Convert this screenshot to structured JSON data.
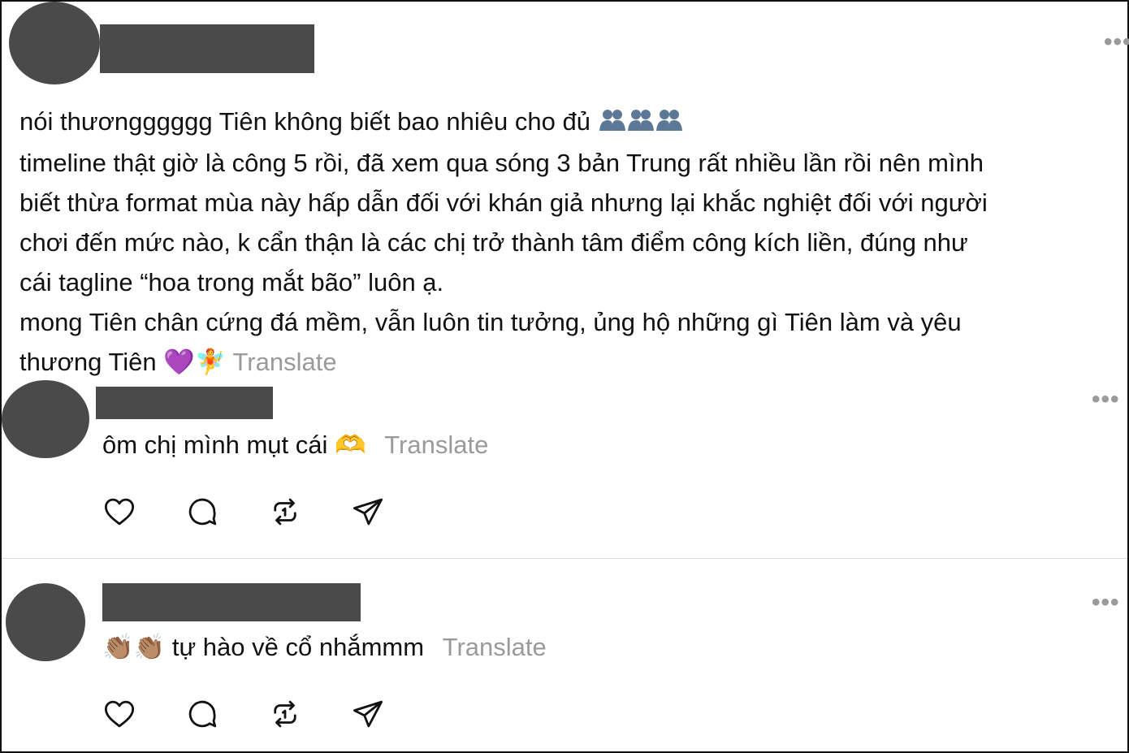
{
  "post": {
    "lines": [
      "nói thươngggggg Tiên không biết bao nhiêu cho đủ",
      "timeline thật giờ là công 5 rồi, đã xem qua sóng 3 bản Trung rất nhiều lần rồi nên mình",
      "biết thừa format mùa này hấp dẫn đối với khán giả nhưng lại khắc nghiệt đối với người",
      "chơi đến mức nào, k cẩn thận là các chị trở thành tâm điểm công kích liền, đúng như",
      "cái tagline “hoa trong mắt bão” luôn ạ.",
      "mong Tiên chân cứng đá mềm, vẫn luôn tin tưởng, ủng hộ những gì Tiên làm và yêu",
      "thương Tiên"
    ],
    "line1_emoji": "👥👥👥",
    "last_line_emoji": "💜🧚",
    "translate_label": "Translate"
  },
  "replies": [
    {
      "text": "ôm chị mình mụt cái",
      "emoji": "🫶",
      "translate_label": "Translate"
    },
    {
      "emoji": "👏🏽👏🏽",
      "text": "tự hào về cổ nhắmmm",
      "translate_label": "Translate"
    }
  ],
  "more_label": "•••",
  "icons": [
    "heart-icon",
    "comment-icon",
    "repost-icon",
    "share-icon"
  ],
  "colors": {
    "redaction": "#4a4a4a",
    "muted": "#9a9a9a",
    "text": "#111111"
  }
}
